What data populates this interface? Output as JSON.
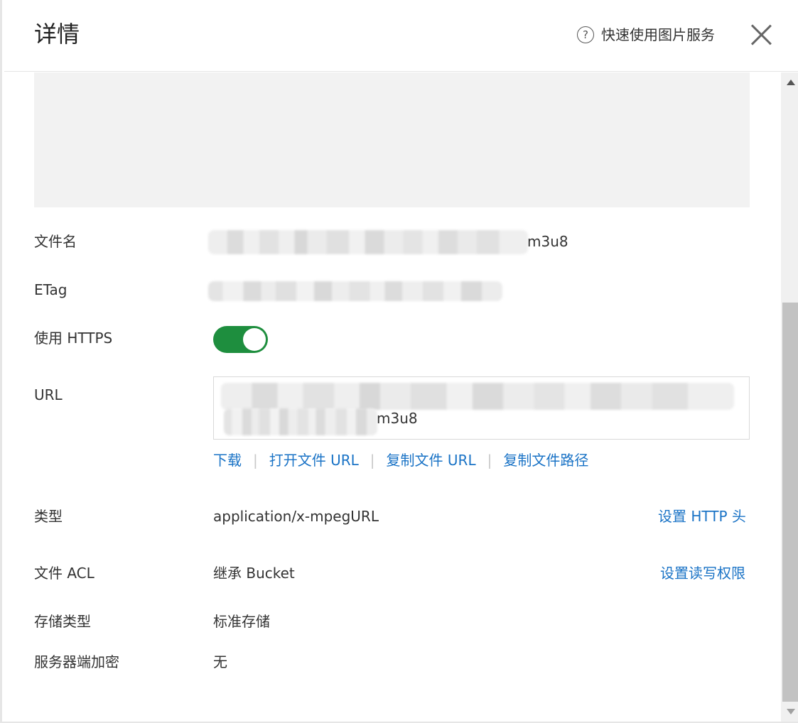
{
  "header": {
    "title": "详情",
    "help_label": "快速使用图片服务",
    "help_icon": "question-circle-icon",
    "close_icon": "close-icon"
  },
  "fields": {
    "filename": {
      "label": "文件名",
      "value_suffix": "m3u8"
    },
    "etag": {
      "label": "ETag"
    },
    "https": {
      "label": "使用 HTTPS",
      "enabled": true
    },
    "url": {
      "label": "URL",
      "value_suffix": "m3u8"
    },
    "type": {
      "label": "类型",
      "value": "application/x-mpegURL",
      "action": "设置 HTTP 头"
    },
    "acl": {
      "label": "文件 ACL",
      "value": "继承 Bucket",
      "action": "设置读写权限"
    },
    "storage": {
      "label": "存储类型",
      "value": "标准存储"
    },
    "encryption": {
      "label": "服务器端加密",
      "value": "无"
    }
  },
  "url_actions": {
    "download": "下载",
    "open_url": "打开文件 URL",
    "copy_url": "复制文件 URL",
    "copy_path": "复制文件路径",
    "separator": "|"
  },
  "colors": {
    "accent": "#1a73c6",
    "toggle_on": "#1e8e3e"
  }
}
